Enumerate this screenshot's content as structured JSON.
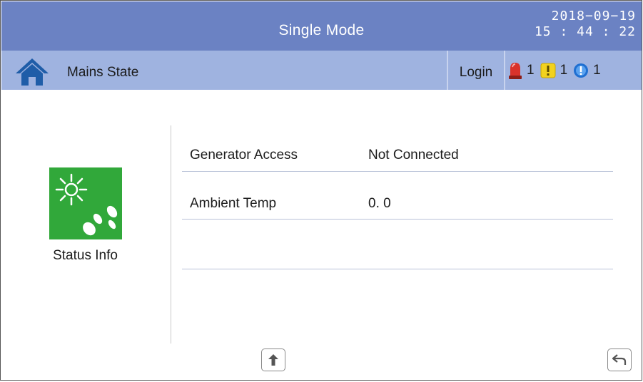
{
  "header": {
    "title": "Single Mode",
    "date": "2018−09−19",
    "time": "15 : 44 : 22"
  },
  "statusbar": {
    "home_icon": "home-icon",
    "page_title": "Mains State",
    "login_label": "Login",
    "alarms": [
      {
        "icon": "siren-icon",
        "count": "1",
        "color": "#d9322b"
      },
      {
        "icon": "warning-icon",
        "count": "1",
        "color": "#f2d21e"
      },
      {
        "icon": "info-icon",
        "count": "1",
        "color": "#1f6fd1"
      }
    ]
  },
  "sidebar": {
    "icon": "sun-status-icon",
    "icon_color": "#31a83a",
    "label": "Status Info"
  },
  "info_rows": [
    {
      "label": "Generator Access",
      "value": "Not Connected"
    },
    {
      "label": "Ambient Temp",
      "value": "0. 0"
    }
  ],
  "buttons": {
    "page_up": "arrow-up-icon",
    "back": "return-icon"
  },
  "colors": {
    "title_bar": "#6b82c3",
    "status_bar": "#9fb3e0",
    "home_icon": "#1f5da8"
  }
}
